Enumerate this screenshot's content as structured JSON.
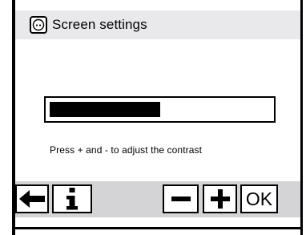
{
  "window": {
    "title": "Screen settings",
    "title_icon": "screen-settings-icon"
  },
  "contrast": {
    "level": 0.5,
    "hint": "Press + and - to adjust the contrast"
  },
  "buttons": {
    "back": {
      "icon": "arrow-left-icon"
    },
    "info": {
      "icon": "info-icon"
    },
    "minus": {
      "icon": "minus-icon"
    },
    "plus": {
      "icon": "plus-icon"
    },
    "ok": {
      "label": "OK"
    }
  },
  "colors": {
    "title_bar": "#e9e9ec",
    "button_bar": "#d4d4d6",
    "foreground": "#000000"
  }
}
